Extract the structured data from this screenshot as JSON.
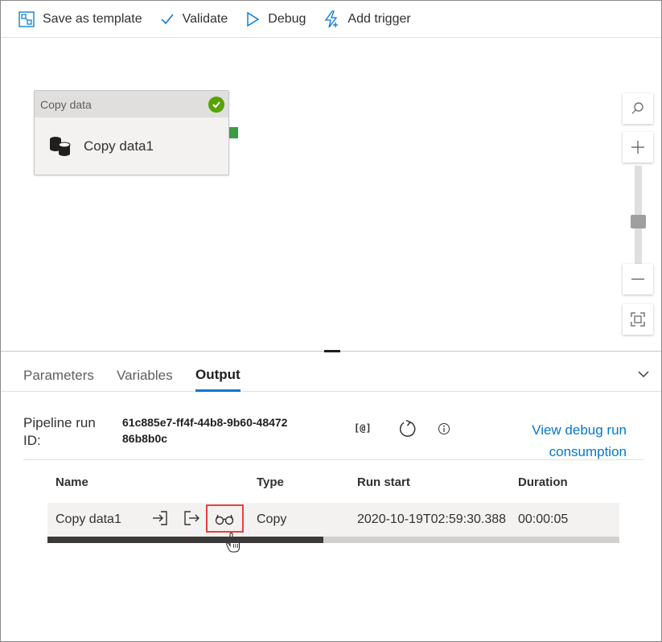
{
  "toolbar": {
    "save_template": "Save as template",
    "validate": "Validate",
    "debug": "Debug",
    "add_trigger": "Add trigger"
  },
  "activity": {
    "type_label": "Copy data",
    "name": "Copy data1",
    "status_icon": "success-check-icon",
    "icon": "database-copy-icon"
  },
  "tabs": [
    "Parameters",
    "Variables",
    "Output"
  ],
  "output": {
    "run_id_label": "Pipeline run ID:",
    "run_id_value": "61c885e7-ff4f-44b8-9b60-4847286b8b0c",
    "at_icon_text": "[@]",
    "debug_link": "View debug run consumption"
  },
  "table": {
    "headers": [
      "Name",
      "Type",
      "Run start",
      "Duration"
    ],
    "rows": [
      {
        "name": "Copy data1",
        "type": "Copy",
        "run_start": "2020-10-19T02:59:30.388",
        "duration": "00:00:05"
      }
    ]
  },
  "colors": {
    "accent": "#0078d4",
    "success": "#57a300",
    "highlight": "#e8413c"
  }
}
